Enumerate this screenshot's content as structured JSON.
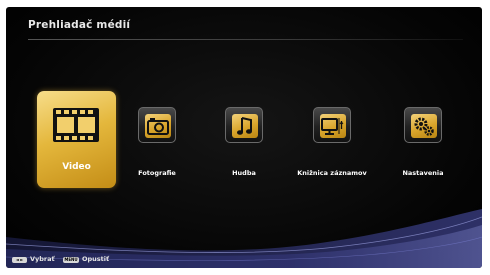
{
  "header": {
    "title": "Prehliadač médií"
  },
  "menu": {
    "items": [
      {
        "label": "Video",
        "icon": "film-icon",
        "selected": true
      },
      {
        "label": "Fotografie",
        "icon": "camera-icon",
        "selected": false
      },
      {
        "label": "Hudba",
        "icon": "music-note-icon",
        "selected": false
      },
      {
        "label": "Knižnica záznamov",
        "icon": "recording-library-icon",
        "selected": false
      },
      {
        "label": "Nastavenia",
        "icon": "gears-icon",
        "selected": false
      }
    ]
  },
  "footer": {
    "nav_key_glyph": "◄ ►",
    "select_label": "Vybrať",
    "menu_key_glyph": "MENU",
    "exit_label": "Opustiť"
  },
  "colors": {
    "accent_gold": "#e4b73c",
    "background": "#000000",
    "text": "#ffffff"
  }
}
